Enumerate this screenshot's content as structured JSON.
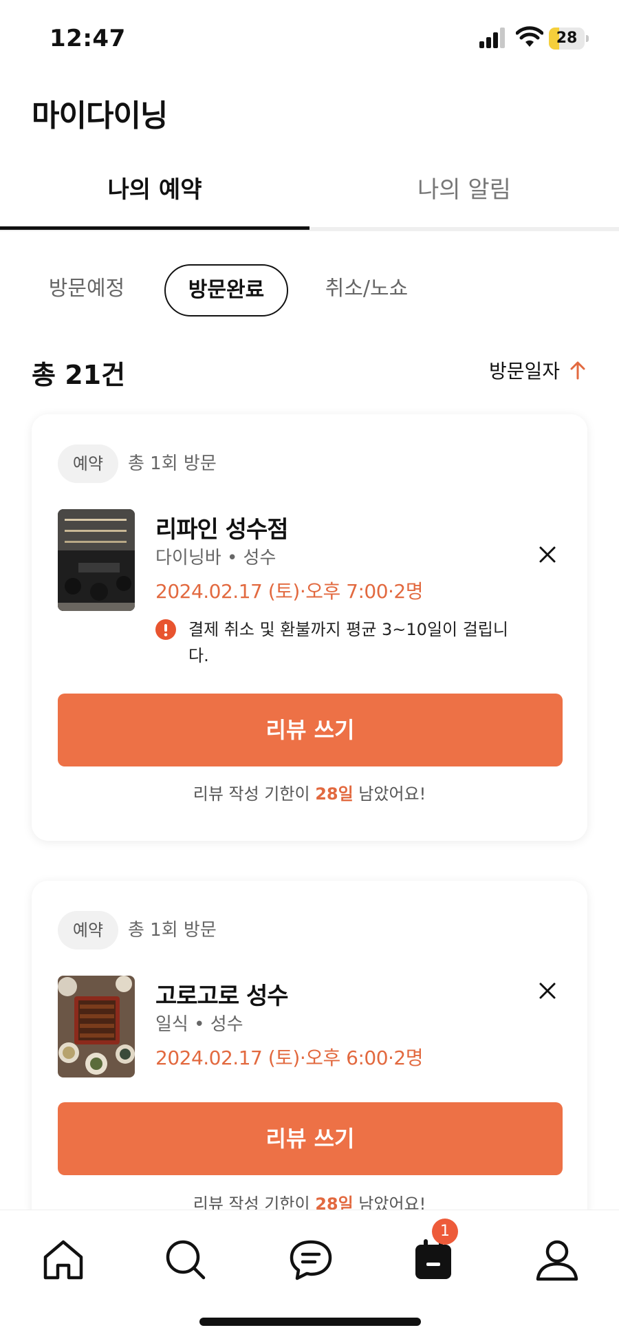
{
  "status_bar": {
    "time": "12:47",
    "battery": "28",
    "battery_level": 0.28
  },
  "header": {
    "title": "마이다이닝"
  },
  "main_tabs": [
    {
      "label": "나의 예약",
      "active": true
    },
    {
      "label": "나의 알림",
      "active": false
    }
  ],
  "filters": [
    {
      "label": "방문예정",
      "selected": false
    },
    {
      "label": "방문완료",
      "selected": true
    },
    {
      "label": "취소/노쇼",
      "selected": false
    }
  ],
  "summary": {
    "total": "총 21건",
    "sort_label": "방문일자"
  },
  "reservations": [
    {
      "badge": "예약",
      "visit_count": "총 1회 방문",
      "name": "리파인 성수점",
      "meta": "다이닝바 • 성수",
      "datetime": "2024.02.17 (토)·오후 7:00·2명",
      "notice": "결제 취소 및 환불까지 평균 3~10일이 걸립니다.",
      "review_label": "리뷰 쓰기",
      "deadline_prefix": "리뷰 작성 기한이 ",
      "deadline_days": "28일",
      "deadline_suffix": " 남았어요!"
    },
    {
      "badge": "예약",
      "visit_count": "총 1회 방문",
      "name": "고로고로 성수",
      "meta": "일식 • 성수",
      "datetime": "2024.02.17 (토)·오후 6:00·2명",
      "review_label": "리뷰 쓰기",
      "deadline_prefix": "리뷰 작성 기한이 ",
      "deadline_days": "28일",
      "deadline_suffix": " 남았어요!"
    }
  ],
  "bottom_nav": {
    "items": [
      "home-icon",
      "search-icon",
      "chat-icon",
      "calendar-icon",
      "profile-icon"
    ],
    "active": "calendar-icon",
    "calendar_badge": "1"
  },
  "colors": {
    "accent": "#ed7146",
    "accent_text": "#e2693f",
    "dark": "#111111"
  }
}
